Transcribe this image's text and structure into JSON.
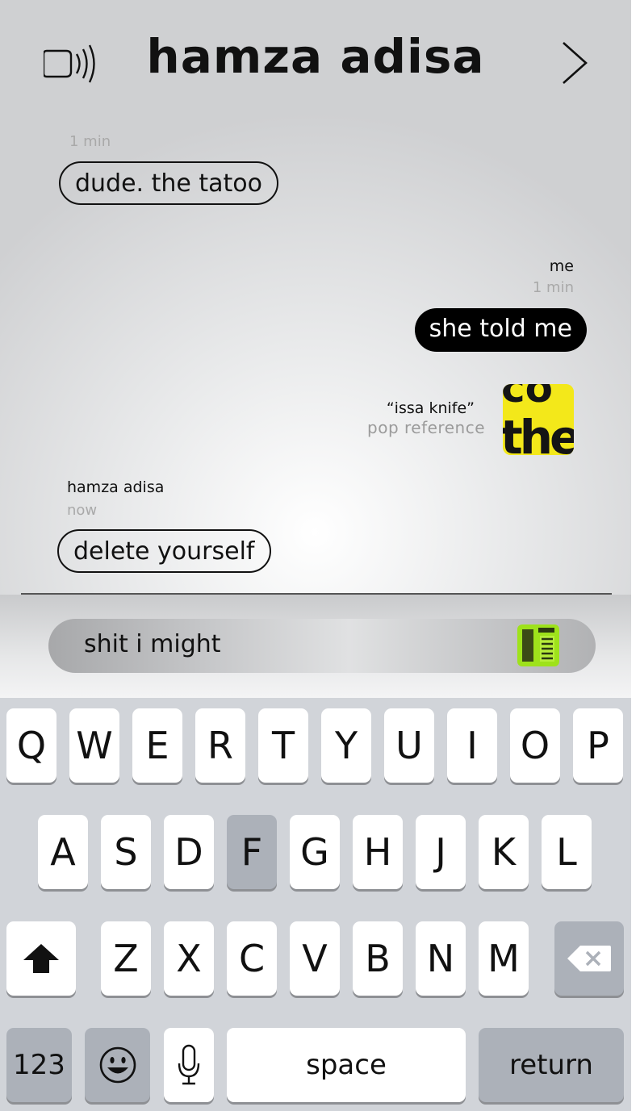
{
  "header": {
    "title": "hamza adisa",
    "left_icon": "speaker-volume-icon",
    "right_icon": "chevron-right-icon"
  },
  "messages": [
    {
      "direction": "in",
      "timestamp": "1 min",
      "text": "dude. the tatoo"
    },
    {
      "direction": "out",
      "sender": "me",
      "timestamp": "1 min",
      "text": "she told me"
    },
    {
      "direction": "out",
      "type": "reference",
      "title": "“issa knife”",
      "subtitle": "pop reference",
      "thumbnail_text": "the"
    },
    {
      "direction": "in",
      "sender": "hamza adisa",
      "timestamp": "now",
      "text": "delete yourself"
    }
  ],
  "composer": {
    "value": "shit i might",
    "sticker_icon": "sticker-icon"
  },
  "keyboard": {
    "row1": [
      "Q",
      "W",
      "E",
      "R",
      "T",
      "Y",
      "U",
      "I",
      "O",
      "P"
    ],
    "row2": [
      "A",
      "S",
      "D",
      "F",
      "G",
      "H",
      "J",
      "K",
      "L"
    ],
    "row3": [
      "Z",
      "X",
      "C",
      "V",
      "B",
      "N",
      "M"
    ],
    "pressed_key": "F",
    "numbers_label": "123",
    "space_label": "space",
    "return_label": "return",
    "shift_icon": "shift-arrow-icon",
    "delete_icon": "backspace-icon",
    "emoji_icon": "emoji-icon",
    "mic_icon": "microphone-icon"
  },
  "colors": {
    "outgoing_bubble": "#000000",
    "timestamp": "#a9a9a9",
    "keyboard_bg": "#d1d4d9",
    "sticker_green": "#9ee21b",
    "thumbnail_yellow": "#f3e81a"
  }
}
